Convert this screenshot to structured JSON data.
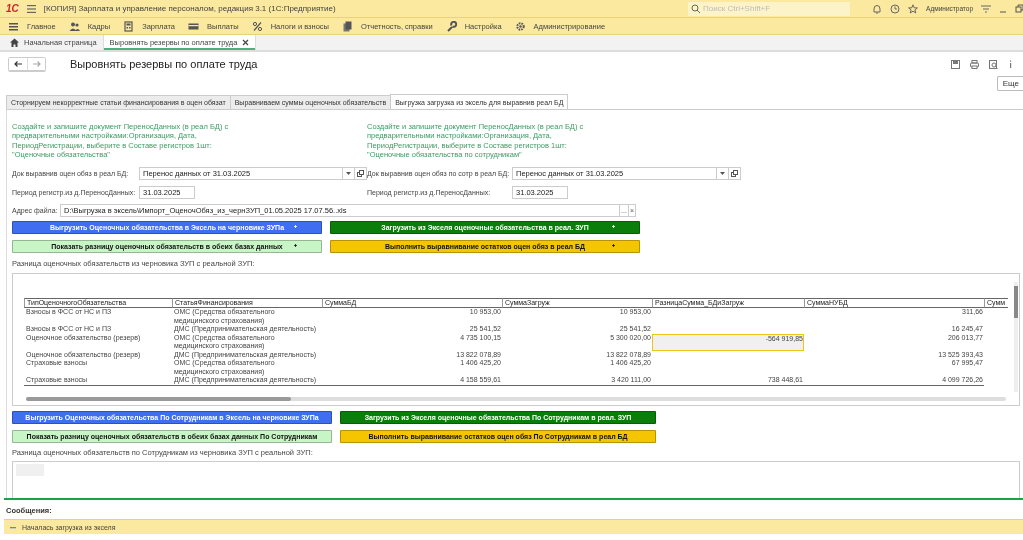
{
  "window": {
    "logo": "1С",
    "title": "[КОПИЯ] Зарплата и управление персоналом, редакция 3.1  (1С:Предприятие)",
    "search": {
      "placeholder": "Поиск Ctrl+Shift+F"
    },
    "user": "Администратор"
  },
  "menu": [
    {
      "label": "Главное",
      "kind": "lines"
    },
    {
      "label": "Кадры",
      "kind": "people"
    },
    {
      "label": "Зарплата",
      "kind": "calc"
    },
    {
      "label": "Выплаты",
      "kind": "card"
    },
    {
      "label": "Налоги и взносы",
      "kind": "percent"
    },
    {
      "label": "Отчетность, справки",
      "kind": "docs"
    },
    {
      "label": "Настройка",
      "kind": "wrench"
    },
    {
      "label": "Администрирование",
      "kind": "gear"
    }
  ],
  "open_tabs": [
    {
      "label": "Начальная страница",
      "kind": "home",
      "selected": false
    },
    {
      "label": "Выровнять резервы по оплате труда",
      "kind": "closable",
      "selected": true
    }
  ],
  "form": {
    "title": "Выровнять резервы по оплате труда",
    "more_button": "Еще",
    "tabs": [
      {
        "label": "Сторнируем некорректные статьи финансирования в оцен обязат",
        "selected": false
      },
      {
        "label": "Выравниваем суммы оценочных обязательств",
        "selected": false
      },
      {
        "label": "Выгрузка загрузка из эксель для выравнив реал БД",
        "selected": true
      }
    ],
    "hints": [
      "Создайте и запишите документ ПереносДанных (в реал БД) с предварительными настройками:Организация, Дата, ПериодРегистрации, выберите в Составе регистров 1шт: \"Оценочные обязательства\"",
      "Создайте и запишите документ ПереносДанных (в реал БД) с предварительными настройками:Организация, Дата, ПериодРегистрации, выберите в Составе регистров 1шт: \"Оценочные обязательства по сотрудникам\""
    ],
    "doc_fields": [
      {
        "label": "Док выравнив оцен обяз в реал БД:",
        "value": "Перенос данных  от 31.03.2025"
      },
      {
        "label": "Док выравнив оцен обяз по сотр в реал БД:",
        "value": "Перенос данных  от 31.03.2025"
      }
    ],
    "period_fields": [
      {
        "label": "Период регистр.из д.ПереносДанных:",
        "value": "31.03.2025"
      },
      {
        "label": "Период регистр.из д.ПереносДанных:",
        "value": "31.03.2025"
      }
    ],
    "file": {
      "label": "Адрес файла:",
      "value": "D:\\Выгрузка в эксель\\Импорт_ОценочОбяз_из_чернЗУП_01.05.2025 17.07.56..xls",
      "choose_button": "...",
      "clear_button": "×"
    },
    "buttons_1": [
      {
        "label": "Выгрузить Оценочных обязательства в Эксель на черновике ЗУПа",
        "color": "#3f6ff0"
      },
      {
        "label": "Загрузить из Экселя оценочные обязательства в реал. ЗУП",
        "color": "#0b7d0b"
      },
      {
        "label": "Показать разницу оценочных обязательств в обеих базах данных",
        "color": "#c8f5c6"
      },
      {
        "label": "Выполнить выравнивание остатков оцен обяз в реал БД",
        "color": "#f5c600"
      }
    ],
    "table_1_label": "Разница оценочных обязательств из черновика ЗУП с реальной ЗУП:",
    "table_1": {
      "columns": [
        "ТипОценочногоОбязательства",
        "СтатьяФинансирования",
        "СуммаБД",
        "СуммаЗагруж",
        "РазницаСумма_БДиЗагруж",
        "СуммаНУБД",
        "Сумм"
      ],
      "rows": [
        {
          "type": "Взносы в ФСС от НС и ПЗ",
          "article": "ОМС (Средства обязательного медицинского страхования)",
          "sum_bd": "10 953,00",
          "sum_loaded": "10 953,00",
          "diff": {
            "selected": false
          },
          "sum_nu": "311,66"
        },
        {
          "type": "Взносы в ФСС от НС и ПЗ",
          "article": "ДМС (Предпринимательская деятельность)",
          "sum_bd": "25 541,52",
          "sum_loaded": "25 541,52",
          "diff": {
            "selected": false
          },
          "sum_nu": "16 245,47"
        },
        {
          "type": "Оценочное обязательство (резерв)",
          "article": "ОМС (Средства обязательного медицинского страхования)",
          "sum_bd": "4 735 100,15",
          "sum_loaded": "5 300 020,00",
          "diff": {
            "text": "-564 919,85",
            "selected": true
          },
          "sum_nu": "206 013,77"
        },
        {
          "type": "Оценочное обязательство (резерв)",
          "article": "ДМС (Предпринимательская деятельность)",
          "sum_bd": "13 822 078,89",
          "sum_loaded": "13 822 078,89",
          "diff": {
            "selected": false
          },
          "sum_nu": "13 525 393,43"
        },
        {
          "type": "Страховые взносы",
          "article": "ОМС (Средства обязательного медицинского страхования)",
          "sum_bd": "1 406 425,20",
          "sum_loaded": "1 406 425,20",
          "diff": {
            "selected": false
          },
          "sum_nu": "67 995,47"
        },
        {
          "type": "Страховые взносы",
          "article": "ДМС (Предпринимательская деятельность)",
          "sum_bd": "4 158 559,61",
          "sum_loaded": "3 420 111,00",
          "diff": {
            "text": "738 448,61",
            "selected": false
          },
          "sum_nu": "4 099 726,26"
        }
      ]
    },
    "buttons_2": [
      {
        "label": "Выгрузить Оценочных обязательства По Сотрудникам в Эксель на черновике ЗУПа",
        "color": "#3f6ff0"
      },
      {
        "label": "Загрузить из Экселя оценочные обязательства По Сотрудникам в реал. ЗУП",
        "color": "#0b7d0b"
      },
      {
        "label": "Показать разницу оценочных обязательств в обеих базах данных По Сотрудникам",
        "color": "#c8f5c6"
      },
      {
        "label": "Выполнить выравнивание остатков оцен обяз По Сотрудникам в реал БД",
        "color": "#f5c600"
      }
    ],
    "table_2_label": "Разница оценочных обязательств по Сотрудникам из черновика ЗУП с реальной ЗУП:"
  },
  "messages": {
    "title": "Сообщения:",
    "items": [
      {
        "text": "Началась загрузка из экселя"
      }
    ]
  }
}
